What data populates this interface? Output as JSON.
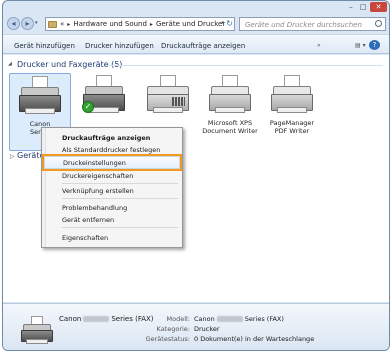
{
  "window": {
    "controls": {
      "minimize": "–",
      "maximize": "□",
      "close": "✕"
    }
  },
  "address": {
    "crumbs": [
      "Hardware und Sound",
      "Geräte und Drucker"
    ],
    "separator": "▸",
    "overflow": "«",
    "refresh": "↻"
  },
  "search": {
    "placeholder": "Geräte und Drucker durchsuchen"
  },
  "toolbar": {
    "add_device": "Gerät hinzufügen",
    "add_printer": "Drucker hinzufügen",
    "show_jobs": "Druckaufträge anzeigen",
    "more": "»",
    "view": "▤ ▾",
    "help": "?"
  },
  "groups": {
    "printers_header": "Drucker und Faxgeräte (5)",
    "devices_header": "Geräte"
  },
  "devices": [
    {
      "name_top": "Canon",
      "name_bottom": "Series",
      "selected": true
    },
    {
      "name_top": "",
      "name_bottom": "",
      "default": true,
      "default_mark": "✓"
    },
    {
      "name_top": "",
      "name_bottom": ""
    },
    {
      "name_top": "Microsoft XPS",
      "name_bottom": "Document Writer"
    },
    {
      "name_top": "PageManager",
      "name_bottom": "PDF Writer"
    }
  ],
  "context_menu": {
    "items": [
      "Druckaufträge anzeigen",
      "Als Standarddrucker festlegen",
      "Druckeinstellungen",
      "Druckereigenschaften",
      "Verknüpfung erstellen",
      "Problembehandlung",
      "Gerät entfernen",
      "Eigenschaften"
    ],
    "highlighted": "Druckeinstellungen"
  },
  "details": {
    "name_prefix": "Canon",
    "name_suffix": "Series (FAX)",
    "model_label": "Modell:",
    "model_prefix": "Canon",
    "model_suffix": "Series (FAX)",
    "category_label": "Kategorie:",
    "category_value": "Drucker",
    "status_label": "Gerätestatus:",
    "status_value": "0 Dokument(e) in der Warteschlange"
  },
  "colors": {
    "highlight_outline": "#f39a1e",
    "selection_fill": "#dcecfc",
    "group_header": "#1e3a6e",
    "default_badge": "#32a232"
  }
}
